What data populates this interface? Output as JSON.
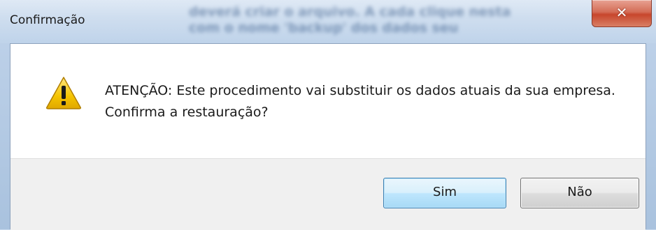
{
  "window": {
    "title": "Confirmação",
    "background_text": "deverá criar o arquivo. A cada clique nesta com o nome 'backup' dos dados seu"
  },
  "dialog": {
    "icon": "warning-triangle-icon",
    "message": "ATENÇÃO: Este procedimento vai substituir os dados atuais da sua empresa. Confirma a restauração?",
    "buttons": {
      "yes_label": "Sim",
      "no_label": "Não"
    }
  },
  "colors": {
    "accent_border": "#3c7fb1",
    "close_button": "#c7462c",
    "warning_yellow": "#f5c400"
  }
}
